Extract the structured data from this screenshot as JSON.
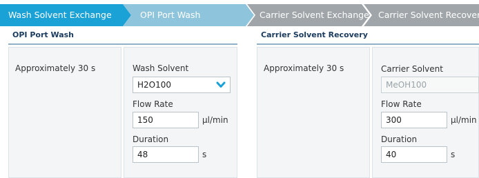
{
  "workflow": {
    "steps": [
      {
        "label": "Wash Solvent Exchange",
        "state": "active"
      },
      {
        "label": "OPI Port Wash",
        "state": "visited"
      },
      {
        "label": "Carrier Solvent Exchange",
        "state": "inactive"
      },
      {
        "label": "Carrier Solvent Recovery",
        "state": "inactive"
      }
    ],
    "colors": {
      "active": "#1aa1d6",
      "visited": "#8fc4dd",
      "inactive": "#9fa5a8"
    }
  },
  "opi_port_wash": {
    "title": "OPI Port Wash",
    "info": "Approximately 30 s",
    "wash_solvent": {
      "label": "Wash Solvent",
      "value": "H2O100",
      "icon": "chevron-down-icon"
    },
    "flow_rate": {
      "label": "Flow Rate",
      "value": "150",
      "unit": "µl/min"
    },
    "duration": {
      "label": "Duration",
      "value": "48",
      "unit": "s"
    }
  },
  "carrier_solvent_recovery": {
    "title": "Carrier Solvent Recovery",
    "info": "Approximately 30 s",
    "carrier_solvent": {
      "label": "Carrier Solvent",
      "value": "MeOH100"
    },
    "flow_rate": {
      "label": "Flow Rate",
      "value": "300",
      "unit": "µl/min"
    },
    "duration": {
      "label": "Duration",
      "value": "40",
      "unit": "s"
    }
  }
}
